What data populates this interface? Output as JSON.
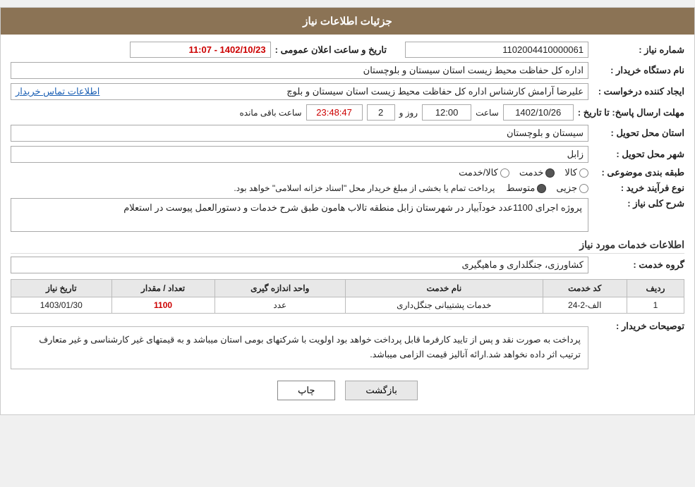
{
  "header": {
    "title": "جزئیات اطلاعات نیاز"
  },
  "fields": {
    "shomareNiaz_label": "شماره نیاز :",
    "shomareNiaz_value": "1102004410000061",
    "namDastgah_label": "نام دستگاه خریدار :",
    "namDastgah_value": "اداره کل حفاظت محیط زیست استان سیستان و بلوچستان",
    "tarikh_label": "تاریخ و ساعت اعلان عمومی :",
    "tarikh_value": "1402/10/23 - 11:07",
    "ejad_label": "ایجاد کننده درخواست :",
    "ejad_value": "علیرضا آرامش کارشناس اداره کل حفاظت محیط زیست استان سیستان و بلوچ",
    "ejad_link": "اطلاعات تماس خریدار",
    "mohlat_label": "مهلت ارسال پاسخ: تا تاریخ :",
    "mohlat_date": "1402/10/26",
    "mohlat_saat_label": "ساعت",
    "mohlat_saat": "12:00",
    "mohlat_roz_label": "روز و",
    "mohlat_roz": "2",
    "mohlat_remaining_label": "ساعت باقی مانده",
    "mohlat_remaining": "23:48:47",
    "ostan_label": "استان محل تحویل :",
    "ostan_value": "سیستان و بلوچستان",
    "shahr_label": "شهر محل تحویل :",
    "shahr_value": "زابل",
    "tabaqe_label": "طبقه بندی موضوعی :",
    "tabaqe_options": [
      "کالا",
      "خدمت",
      "کالا/خدمت"
    ],
    "tabaqe_selected": "خدمت",
    "noe_label": "نوع فرآیند خرید :",
    "noe_options": [
      "جزیی",
      "متوسط"
    ],
    "noe_text": "پرداخت تمام یا بخشی از مبلغ خریدار محل \"اسناد خزانه اسلامی\" خواهد بود.",
    "sharh_label": "شرح کلی نیاز :",
    "sharh_value": "پروژه اجرای 1100عدد خودآبیار در شهرستان زابل منطقه تالاب هامون طبق شرح خدمات و دستورالعمل پیوست در استعلام",
    "khadamat_title": "اطلاعات خدمات مورد نیاز",
    "goroh_label": "گروه خدمت :",
    "goroh_value": "کشاورزی، جنگلداری و ماهیگیری",
    "table": {
      "headers": [
        "ردیف",
        "کد خدمت",
        "نام خدمت",
        "واحد اندازه گیری",
        "تعداد / مقدار",
        "تاریخ نیاز"
      ],
      "rows": [
        {
          "radif": "1",
          "kod": "الف-2-24",
          "nam": "خدمات پشتیبانی جنگل‌داری",
          "vahed": "عدد",
          "tedad": "1100",
          "tarikh": "1403/01/30"
        }
      ]
    },
    "tosif_label": "توصیحات خریدار :",
    "tosif_value": "پرداخت به صورت نقد و پس از تایید کارفرما قابل پرداخت خواهد بود اولویت با شرکتهای بومی استان میباشد و به قیمتهای غیر کارشناسی و غیر متعارف ترتیب اثر داده نخواهد شد.ارائه آنالیز قیمت الزامی میباشد.",
    "btn_print": "چاپ",
    "btn_back": "بازگشت"
  }
}
